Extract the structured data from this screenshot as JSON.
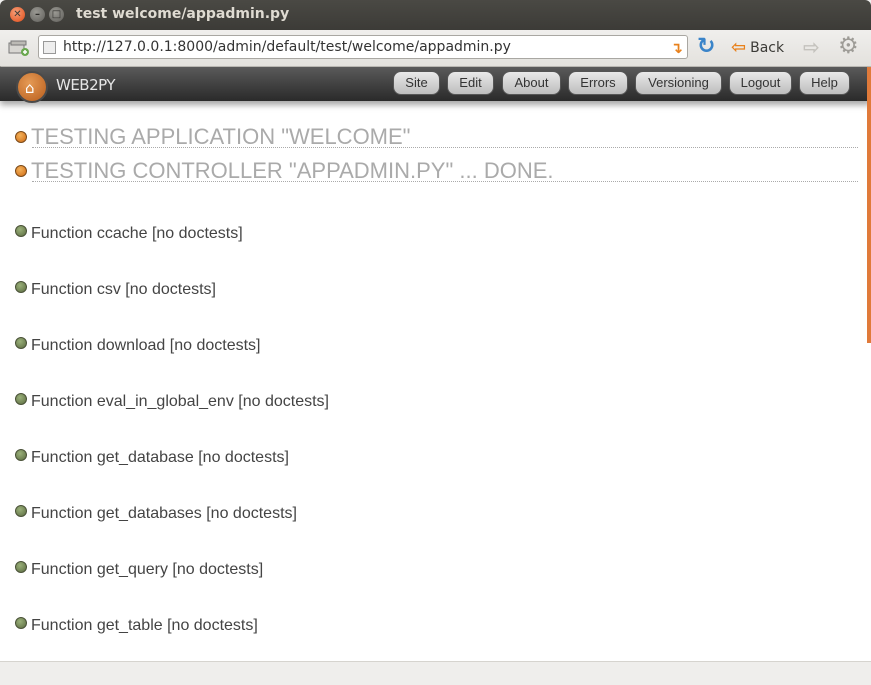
{
  "window": {
    "title": "test welcome/appadmin.py"
  },
  "browser": {
    "url": "http://127.0.0.1:8000/admin/default/test/welcome/appadmin.py",
    "back_label": "Back"
  },
  "app": {
    "logo_text": "WEB2PY",
    "nav": [
      "Site",
      "Edit",
      "About",
      "Errors",
      "Versioning",
      "Logout",
      "Help"
    ]
  },
  "page": {
    "headings": [
      "TESTING APPLICATION \"WELCOME\"",
      "TESTING CONTROLLER \"APPADMIN.PY\" ... DONE."
    ],
    "functions": [
      "Function ccache [no doctests]",
      "Function csv [no doctests]",
      "Function download [no doctests]",
      "Function eval_in_global_env [no doctests]",
      "Function get_database [no doctests]",
      "Function get_databases [no doctests]",
      "Function get_query [no doctests]",
      "Function get_table [no doctests]"
    ]
  },
  "colors": {
    "accent": "#e07a3a",
    "heading": "#aaaaaa",
    "text": "#444444"
  }
}
